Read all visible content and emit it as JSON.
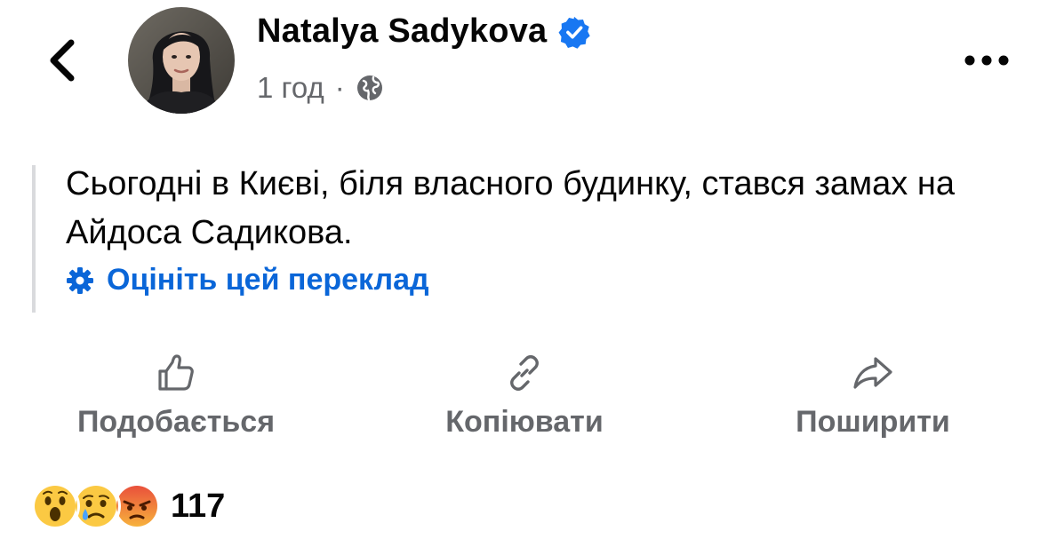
{
  "header": {
    "author_name": "Natalya Sadykova",
    "time": "1 год",
    "separator": "·",
    "verified_color": "#1877f2"
  },
  "post": {
    "text": "Сьогодні в Києві, біля власного будинку, стався замах на Айдоса Садикова.",
    "translate_link": "Оцініть цей переклад",
    "link_color": "#0a66d8"
  },
  "actions": {
    "like_label": "Подобається",
    "copy_label": "Копіювати",
    "share_label": "Поширити"
  },
  "reactions": {
    "icons": [
      "wow-emoji",
      "sad-emoji",
      "angry-emoji"
    ],
    "count": "117"
  }
}
